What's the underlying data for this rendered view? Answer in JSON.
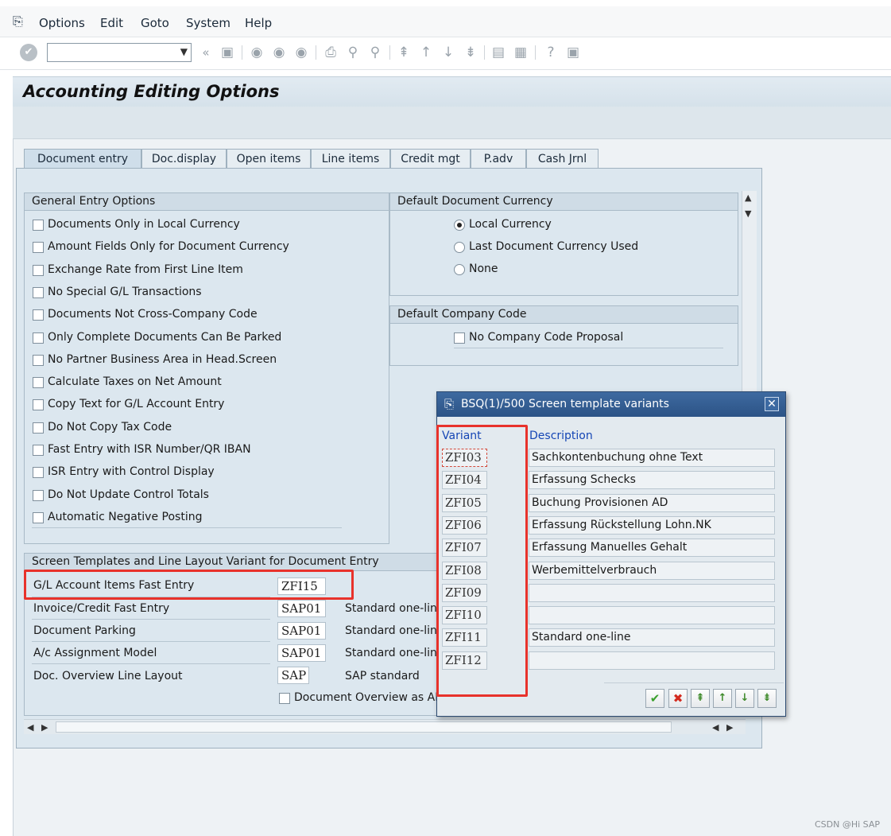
{
  "menu": {
    "items": [
      {
        "label": "Options"
      },
      {
        "label": "Edit"
      },
      {
        "label": "Goto"
      },
      {
        "label": "System"
      },
      {
        "label": "Help"
      }
    ]
  },
  "screen": {
    "title": "Accounting Editing Options"
  },
  "tabs": [
    {
      "label": "Document entry"
    },
    {
      "label": "Doc.display"
    },
    {
      "label": "Open items"
    },
    {
      "label": "Line items"
    },
    {
      "label": "Credit mgt"
    },
    {
      "label": "P.adv"
    },
    {
      "label": "Cash Jrnl"
    }
  ],
  "general_entry": {
    "header": "General Entry Options",
    "options": [
      "Documents Only in Local Currency",
      "Amount Fields Only for Document Currency",
      "Exchange Rate from First Line Item",
      "No Special G/L Transactions",
      "Documents Not Cross-Company Code",
      "Only Complete Documents Can Be Parked",
      "No Partner Business Area in Head.Screen",
      "Calculate Taxes on Net Amount",
      "Copy Text for G/L Account Entry",
      "Do Not Copy Tax Code",
      "Fast Entry with ISR Number/QR IBAN",
      "ISR Entry with Control Display",
      "Do Not Update Control Totals",
      "Automatic Negative Posting"
    ]
  },
  "default_currency": {
    "header": "Default Document Currency",
    "options": [
      "Local Currency",
      "Last Document Currency Used",
      "None"
    ],
    "selected": "Local Currency"
  },
  "default_company": {
    "header": "Default Company Code",
    "option": "No Company Code Proposal"
  },
  "screen_templates": {
    "header": "Screen Templates and Line Layout Variant for Document Entry",
    "rows": [
      {
        "label": "G/L Account Items Fast Entry",
        "value": "ZFI15",
        "desc": ""
      },
      {
        "label": "Invoice/Credit Fast Entry",
        "value": "SAP01",
        "desc": "Standard one-line"
      },
      {
        "label": "Document Parking",
        "value": "SAP01",
        "desc": "Standard one-line"
      },
      {
        "label": "A/c Assignment Model",
        "value": "SAP01",
        "desc": "Standard one-line"
      },
      {
        "label": "Doc. Overview Line Layout",
        "value": "SAP",
        "desc": "SAP standard"
      }
    ],
    "alv_option": "Document Overview as ALV"
  },
  "popup": {
    "title": "BSQ(1)/500 Screen template variants",
    "col_variant": "Variant",
    "col_description": "Description",
    "rows": [
      {
        "variant": "ZFI03",
        "description": "Sachkontenbuchung ohne Text"
      },
      {
        "variant": "ZFI04",
        "description": "Erfassung Schecks"
      },
      {
        "variant": "ZFI05",
        "description": "Buchung Provisionen AD"
      },
      {
        "variant": "ZFI06",
        "description": "Erfassung Rückstellung Lohn.NK"
      },
      {
        "variant": "ZFI07",
        "description": "Erfassung Manuelles Gehalt"
      },
      {
        "variant": "ZFI08",
        "description": "Werbemittelverbrauch"
      },
      {
        "variant": "ZFI09",
        "description": ""
      },
      {
        "variant": "ZFI10",
        "description": ""
      },
      {
        "variant": "ZFI11",
        "description": "Standard one-line"
      },
      {
        "variant": "ZFI12",
        "description": ""
      }
    ],
    "close_glyph": "✕"
  },
  "colors": {
    "highlight": "#e8322b",
    "popup_title": "#2c5386",
    "column_header": "#1546b5"
  },
  "watermark": "CSDN @Hi SAP"
}
